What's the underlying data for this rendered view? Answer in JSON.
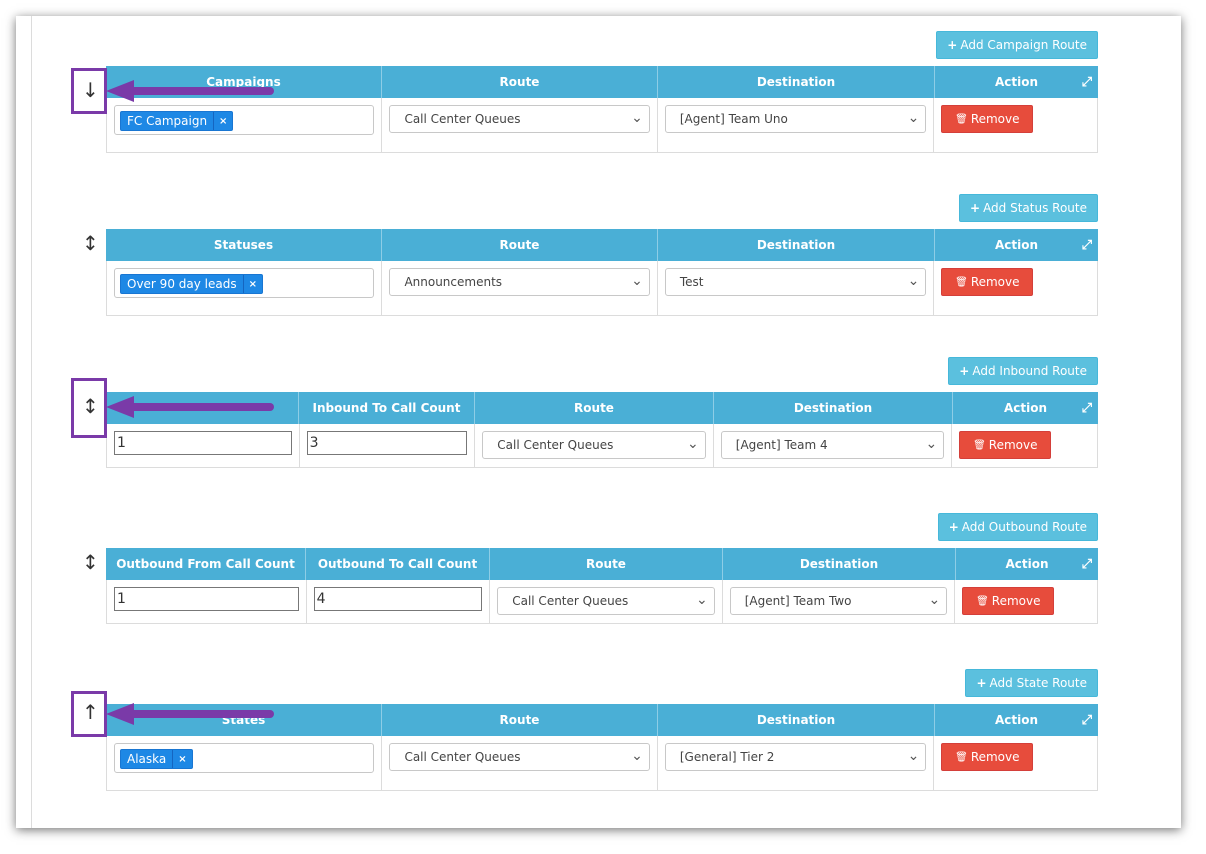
{
  "sections": [
    {
      "add_label": "Add Campaign Route",
      "sort_arrow": "↓",
      "headers": [
        "Campaigns",
        "Route",
        "Destination",
        "Action"
      ],
      "tag": "FC Campaign",
      "route": "Call Center Queues",
      "destination": "[Agent] Team Uno",
      "remove_label": "Remove"
    },
    {
      "add_label": "Add Status Route",
      "sort_arrow": "↕",
      "headers": [
        "Statuses",
        "Route",
        "Destination",
        "Action"
      ],
      "tag": "Over 90 day leads",
      "route": "Announcements",
      "destination": "Test",
      "remove_label": "Remove"
    },
    {
      "add_label": "Add Inbound Route",
      "sort_arrow": "↕",
      "headers": [
        "",
        "Inbound To Call Count",
        "Route",
        "Destination",
        "Action"
      ],
      "from_count": "1",
      "to_count": "3",
      "route": "Call Center Queues",
      "destination": "[Agent] Team 4",
      "remove_label": "Remove"
    },
    {
      "add_label": "Add Outbound Route",
      "sort_arrow": "↕",
      "headers": [
        "Outbound From Call Count",
        "Outbound To Call Count",
        "Route",
        "Destination",
        "Action"
      ],
      "from_count": "1",
      "to_count": "4",
      "route": "Call Center Queues",
      "destination": "[Agent] Team Two",
      "remove_label": "Remove"
    },
    {
      "add_label": "Add State Route",
      "sort_arrow": "↑",
      "headers": [
        "States",
        "Route",
        "Destination",
        "Action"
      ],
      "tag": "Alaska",
      "route": "Call Center Queues",
      "destination": "[General] Tier 2",
      "remove_label": "Remove"
    }
  ],
  "icons": {
    "plus": "+",
    "remove_x": "×",
    "trash": "🗑",
    "expand": "⤢",
    "chevron": "⌄"
  },
  "colors": {
    "header": "#4aafd6",
    "add_button": "#5bc0de",
    "remove_button": "#e74c3c",
    "tag": "#1e88e5",
    "annotation": "#7a3aa8"
  }
}
